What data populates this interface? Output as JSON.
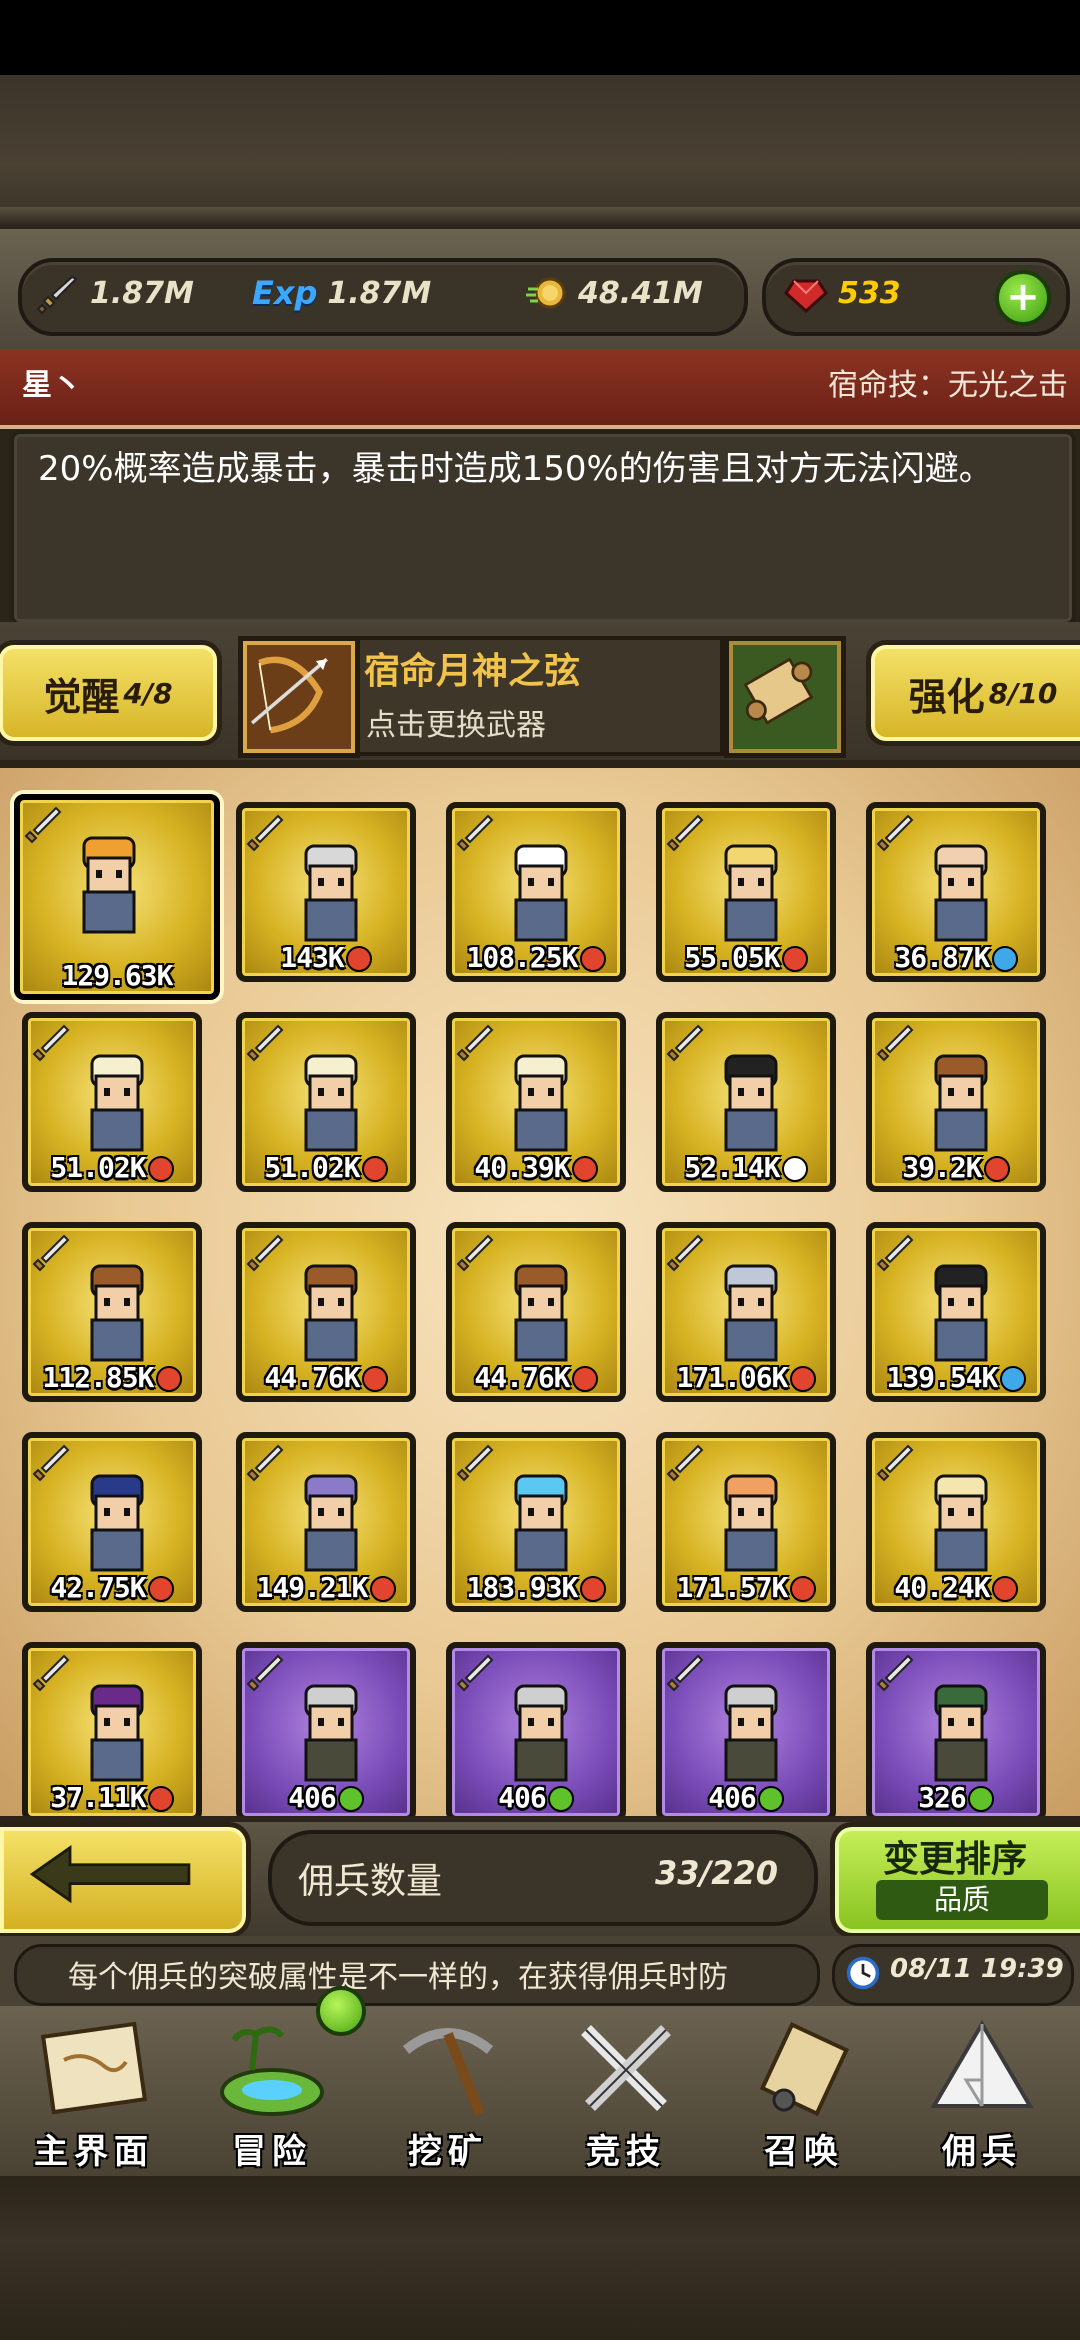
{
  "resources": {
    "attack": "1.87M",
    "exp_label": "Exp",
    "exp": "1.87M",
    "gold": "48.41M",
    "gems": "533"
  },
  "hero": {
    "name": "星丶",
    "skill": "宿命技：无光之击",
    "description": "20%概率造成暴击，暴击时造成150%的伤害且对方无法闪避。"
  },
  "awaken": {
    "label": "觉醒",
    "value": "4/8"
  },
  "enhance": {
    "label": "强化",
    "value": "8/10"
  },
  "weapon": {
    "name": "宿命月神之弦",
    "hint": "点击更换武器"
  },
  "mercenaries": [
    {
      "power": "129.63K",
      "elem": "",
      "rarity": "gold",
      "selected": true
    },
    {
      "power": "143K",
      "elem": "red",
      "rarity": "gold"
    },
    {
      "power": "108.25K",
      "elem": "red",
      "rarity": "gold"
    },
    {
      "power": "55.05K",
      "elem": "red",
      "rarity": "gold"
    },
    {
      "power": "36.87K",
      "elem": "blue",
      "rarity": "gold"
    },
    {
      "power": "51.02K",
      "elem": "red",
      "rarity": "gold"
    },
    {
      "power": "51.02K",
      "elem": "red",
      "rarity": "gold"
    },
    {
      "power": "40.39K",
      "elem": "red",
      "rarity": "gold"
    },
    {
      "power": "52.14K",
      "elem": "white",
      "rarity": "gold"
    },
    {
      "power": "39.2K",
      "elem": "red",
      "rarity": "gold"
    },
    {
      "power": "112.85K",
      "elem": "red",
      "rarity": "gold"
    },
    {
      "power": "44.76K",
      "elem": "red",
      "rarity": "gold"
    },
    {
      "power": "44.76K",
      "elem": "red",
      "rarity": "gold"
    },
    {
      "power": "171.06K",
      "elem": "red",
      "rarity": "gold"
    },
    {
      "power": "139.54K",
      "elem": "blue",
      "rarity": "gold"
    },
    {
      "power": "42.75K",
      "elem": "red",
      "rarity": "gold"
    },
    {
      "power": "149.21K",
      "elem": "red",
      "rarity": "gold"
    },
    {
      "power": "183.93K",
      "elem": "red",
      "rarity": "gold"
    },
    {
      "power": "171.57K",
      "elem": "red",
      "rarity": "gold"
    },
    {
      "power": "40.24K",
      "elem": "red",
      "rarity": "gold"
    },
    {
      "power": "37.11K",
      "elem": "red",
      "rarity": "gold"
    },
    {
      "power": "406",
      "elem": "green",
      "rarity": "purple"
    },
    {
      "power": "406",
      "elem": "green",
      "rarity": "purple"
    },
    {
      "power": "406",
      "elem": "green",
      "rarity": "purple"
    },
    {
      "power": "326",
      "elem": "green",
      "rarity": "purple"
    }
  ],
  "count": {
    "label": "佣兵数量",
    "value": "33/220"
  },
  "sort": {
    "title": "变更排序",
    "mode": "品质"
  },
  "ticker": "每个佣兵的突破属性是不一样的，在获得佣兵时防",
  "clock": "08/11 19:39",
  "nav": [
    "主界面",
    "冒险",
    "挖矿",
    "竞技",
    "召唤",
    "佣兵"
  ],
  "colors": {
    "gold": "#d7b323",
    "purple": "#7a4cb8",
    "elem_red": "#e2452d",
    "elem_blue": "#3fa8e8",
    "elem_white": "#ffffff",
    "elem_green": "#5fc22a"
  }
}
